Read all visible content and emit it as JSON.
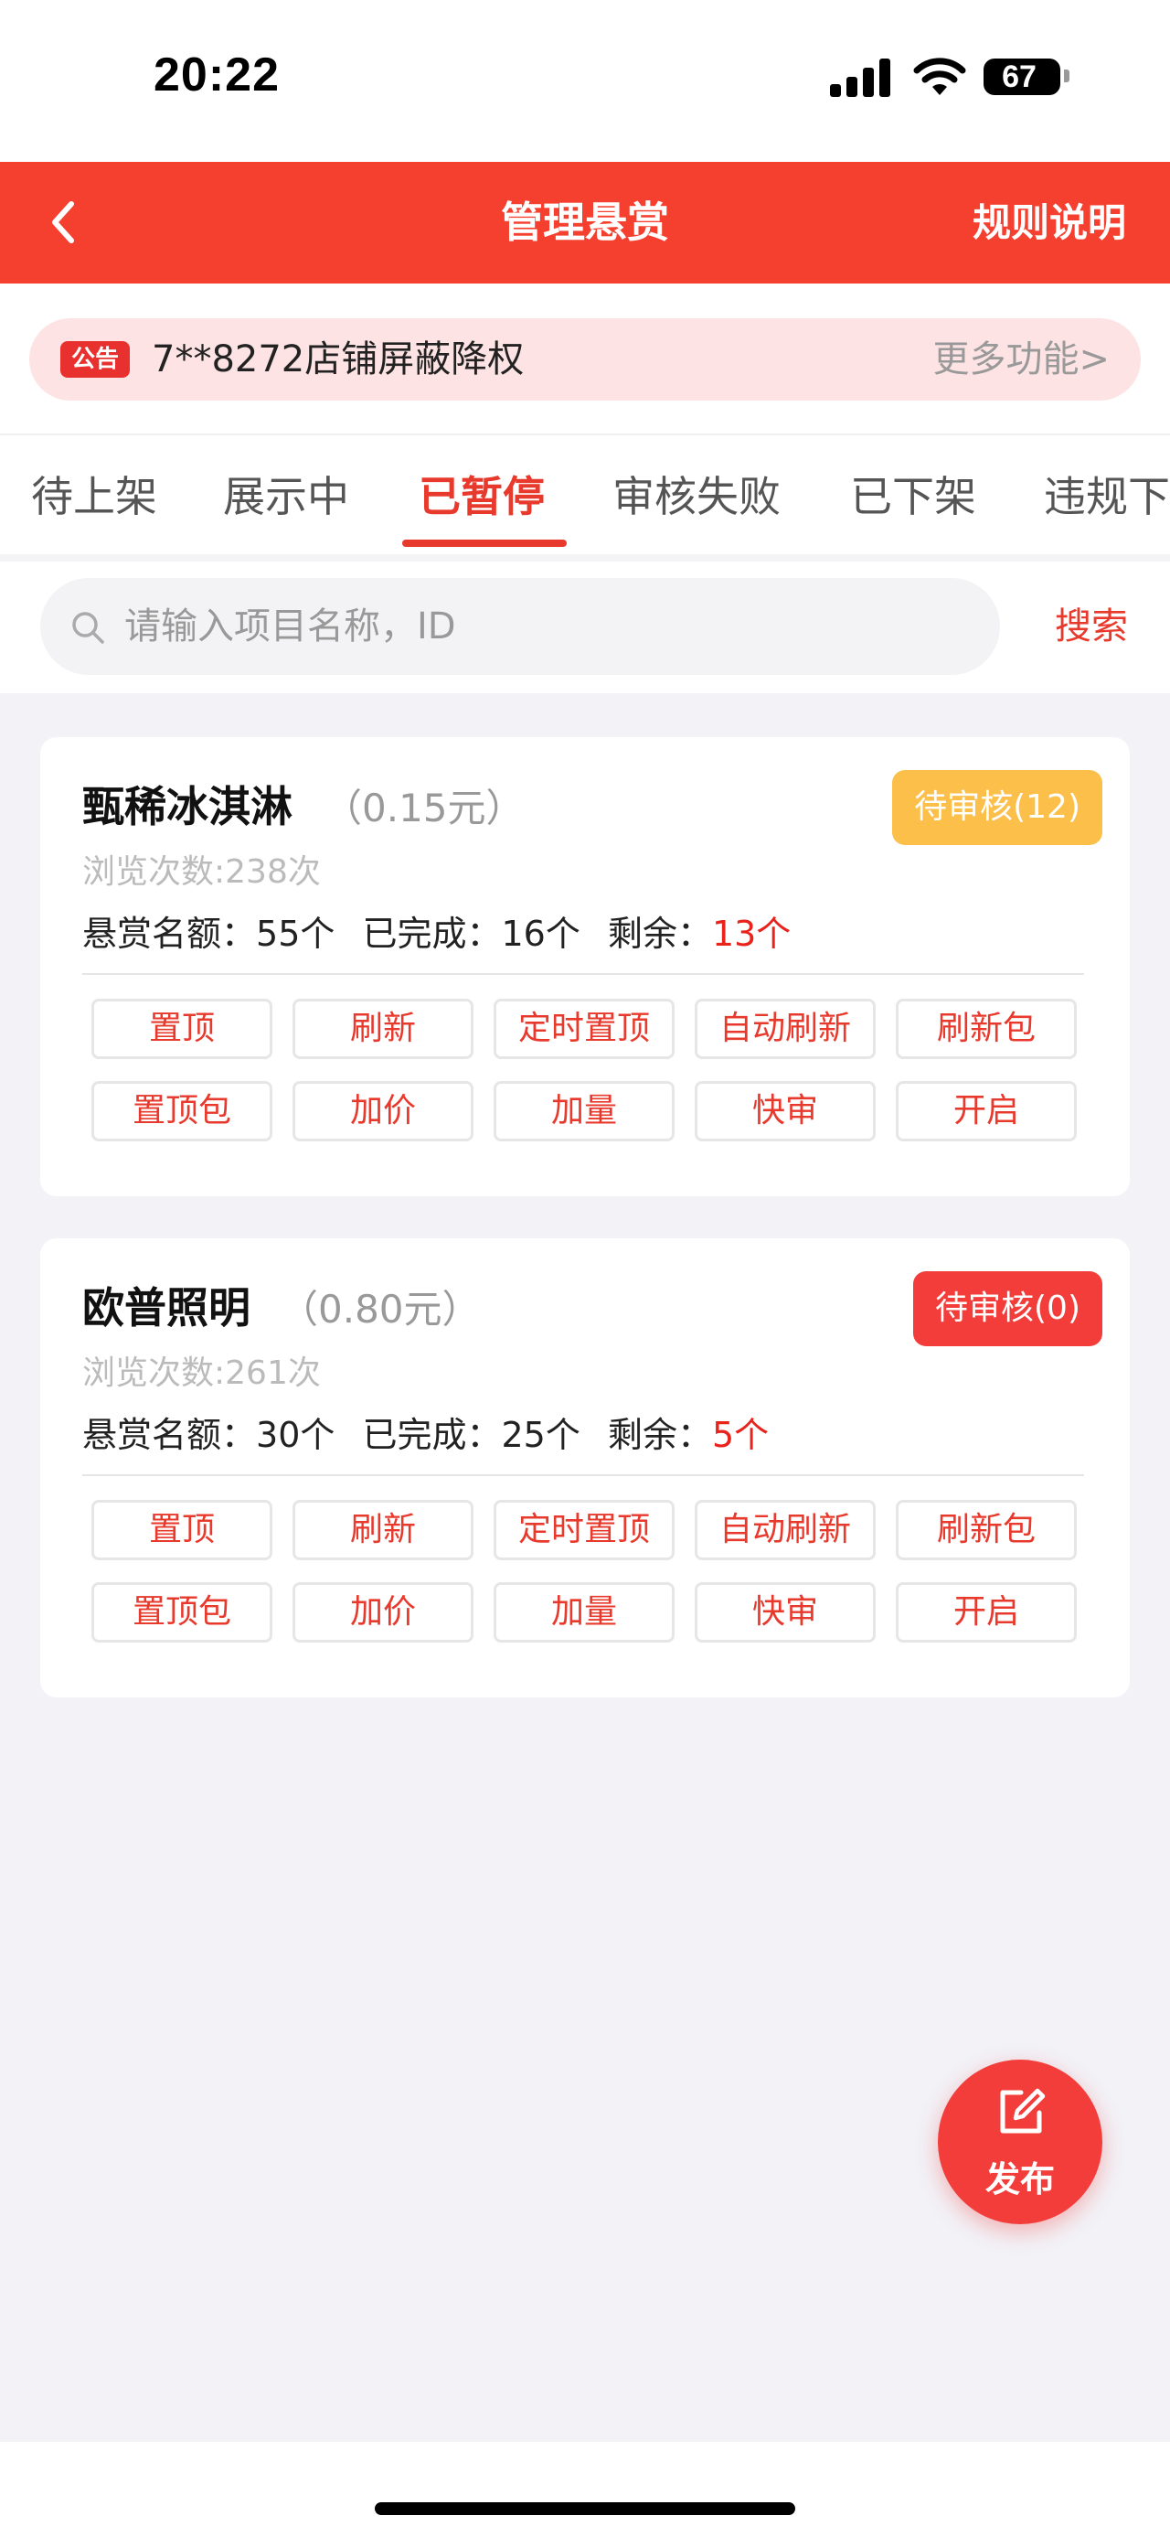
{
  "status_bar": {
    "time": "20:22",
    "battery": "67"
  },
  "header": {
    "title": "管理悬赏",
    "rules": "规则说明"
  },
  "notice": {
    "badge": "公告",
    "text": "7**8272店铺屏蔽降权",
    "more": "更多功能>"
  },
  "tabs": [
    {
      "label": "待上架"
    },
    {
      "label": "展示中"
    },
    {
      "label": "已暂停"
    },
    {
      "label": "审核失败"
    },
    {
      "label": "已下架"
    },
    {
      "label": "违规下"
    }
  ],
  "active_tab": "已暂停",
  "search": {
    "placeholder": "请输入项目名称，ID",
    "button": "搜索"
  },
  "stat_labels": {
    "quota": "悬赏名额：",
    "done": "已完成：",
    "remaining": "剩余："
  },
  "cards": [
    {
      "title": "甄稀冰淇淋",
      "price": "（0.15元）",
      "review_badge": "待审核(12)",
      "badge_color": "#fbbf4a",
      "views": "浏览次数:238次",
      "quota": "55个",
      "done": "16个",
      "remaining": "13个",
      "actions": [
        "置顶",
        "刷新",
        "定时置顶",
        "自动刷新",
        "刷新包",
        "置顶包",
        "加价",
        "加量",
        "快审",
        "开启"
      ]
    },
    {
      "title": "欧普照明",
      "price": "（0.80元）",
      "review_badge": "待审核(0)",
      "badge_color": "#f23d3a",
      "views": "浏览次数:261次",
      "quota": "30个",
      "done": "25个",
      "remaining": "5个",
      "actions": [
        "置顶",
        "刷新",
        "定时置顶",
        "自动刷新",
        "刷新包",
        "置顶包",
        "加价",
        "加量",
        "快审",
        "开启"
      ]
    }
  ],
  "fab": {
    "label": "发布"
  },
  "colors": {
    "brand_red": "#f5402f",
    "accent_red": "#e8392d",
    "warning_yellow": "#fbbf4a"
  }
}
